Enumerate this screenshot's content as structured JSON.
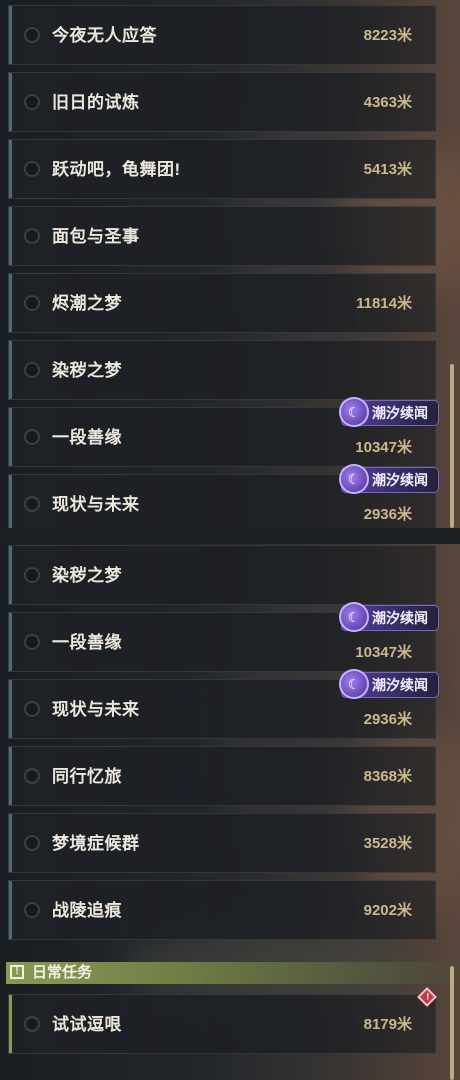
{
  "top_panel": {
    "quests": [
      {
        "title": "今夜无人应答",
        "distance": "8223米"
      },
      {
        "title": "旧日的试炼",
        "distance": "4363米"
      },
      {
        "title": "跃动吧，龟舞团!",
        "distance": "5413米"
      },
      {
        "title": "面包与圣事",
        "distance": ""
      },
      {
        "title": "烬潮之梦",
        "distance": "11814米"
      },
      {
        "title": "染秽之梦",
        "distance": ""
      },
      {
        "title": "一段善缘",
        "distance": "10347米",
        "tag": "潮汐续闻"
      },
      {
        "title": "现状与未来",
        "distance": "2936米",
        "tag": "潮汐续闻"
      }
    ]
  },
  "bottom_panel": {
    "quests": [
      {
        "title": "染秽之梦",
        "distance": ""
      },
      {
        "title": "一段善缘",
        "distance": "10347米",
        "tag": "潮汐续闻"
      },
      {
        "title": "现状与未来",
        "distance": "2936米",
        "tag": "潮汐续闻"
      },
      {
        "title": "同行忆旅",
        "distance": "8368米"
      },
      {
        "title": "梦境症候群",
        "distance": "3528米"
      },
      {
        "title": "战陵追痕",
        "distance": "9202米"
      }
    ],
    "section": {
      "label": "日常任务",
      "icon": "exclamation-box-icon"
    },
    "daily_quests": [
      {
        "title": "试试逗哏",
        "distance": "8179米"
      }
    ]
  },
  "colors": {
    "accent_blue": "#4d6a7a",
    "accent_green": "#8a9a55",
    "distance_gold": "#cbb98e",
    "tag_purple": "#5a3fa2",
    "alert_red": "#c23b4c"
  }
}
